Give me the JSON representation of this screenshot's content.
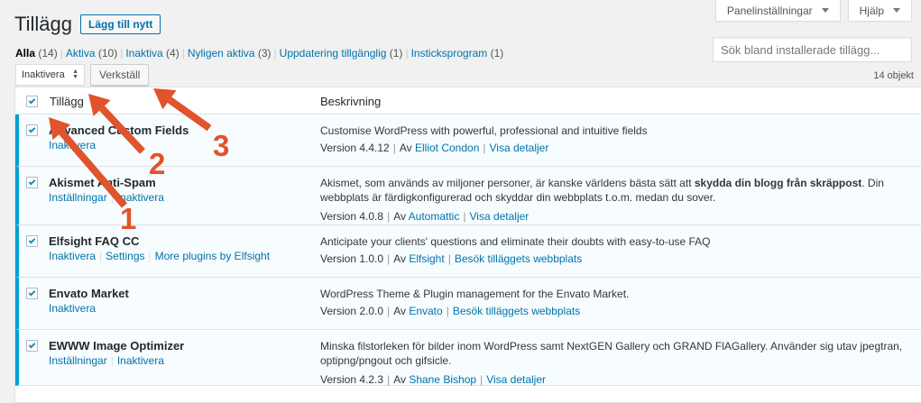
{
  "header": {
    "title": "Tillägg",
    "add_new_label": "Lägg till nytt",
    "screen_options_label": "Panelinställningar",
    "help_label": "Hjälp"
  },
  "filters": [
    {
      "label": "Alla",
      "count": "(14)",
      "current": true
    },
    {
      "label": "Aktiva",
      "count": "(10)"
    },
    {
      "label": "Inaktiva",
      "count": "(4)"
    },
    {
      "label": "Nyligen aktiva",
      "count": "(3)"
    },
    {
      "label": "Uppdatering tillgänglig",
      "count": "(1)"
    },
    {
      "label": "Insticksprogram",
      "count": "(1)"
    }
  ],
  "search": {
    "placeholder": "Sök bland installerade tillägg..."
  },
  "bulk": {
    "selected": "Inaktivera",
    "apply_label": "Verkställ"
  },
  "items_count": "14 objekt",
  "table": {
    "col_name": "Tillägg",
    "col_desc": "Beskrivning"
  },
  "plugins": [
    {
      "name": "Advanced Custom Fields",
      "actions": [
        "Inaktivera"
      ],
      "desc_parts": [
        {
          "text": "Customise WordPress with powerful, professional and intuitive fields"
        }
      ],
      "version": "Version 4.4.12",
      "by": "Av",
      "author": "Elliot Condon",
      "details": "Visa detaljer"
    },
    {
      "name": "Akismet Anti-Spam",
      "actions": [
        "Inställningar",
        "Inaktivera"
      ],
      "desc_parts": [
        {
          "text": "Akismet, som används av miljoner personer, är kanske världens bästa sätt att "
        },
        {
          "text": "skydda din blogg från skräppost",
          "bold": true
        },
        {
          "text": ". Din webbplats är färdigkonfigurerad och skyddar din webbplats t.o.m. medan du sover."
        }
      ],
      "version": "Version 4.0.8",
      "by": "Av",
      "author": "Automattic",
      "details": "Visa detaljer"
    },
    {
      "name": "Elfsight FAQ CC",
      "actions": [
        "Inaktivera",
        "Settings",
        "More plugins by Elfsight"
      ],
      "desc_parts": [
        {
          "text": "Anticipate your clients' questions and eliminate their doubts with easy-to-use FAQ"
        }
      ],
      "version": "Version 1.0.0",
      "by": "Av",
      "author": "Elfsight",
      "details": "Besök tilläggets webbplats"
    },
    {
      "name": "Envato Market",
      "actions": [
        "Inaktivera"
      ],
      "desc_parts": [
        {
          "text": "WordPress Theme & Plugin management for the Envato Market."
        }
      ],
      "version": "Version 2.0.0",
      "by": "Av",
      "author": "Envato",
      "details": "Besök tilläggets webbplats"
    },
    {
      "name": "EWWW Image Optimizer",
      "actions": [
        "Inställningar",
        "Inaktivera"
      ],
      "desc_parts": [
        {
          "text": "Minska filstorleken för bilder inom WordPress samt NextGEN Gallery och GRAND FlAGallery. Använder sig utav jpegtran, optipng/pngout och gifsicle."
        }
      ],
      "version": "Version 4.2.3",
      "by": "Av",
      "author": "Shane Bishop",
      "details": "Visa detaljer"
    }
  ],
  "annotations": {
    "n1": "1",
    "n2": "2",
    "n3": "3",
    "color": "#e0532c"
  }
}
